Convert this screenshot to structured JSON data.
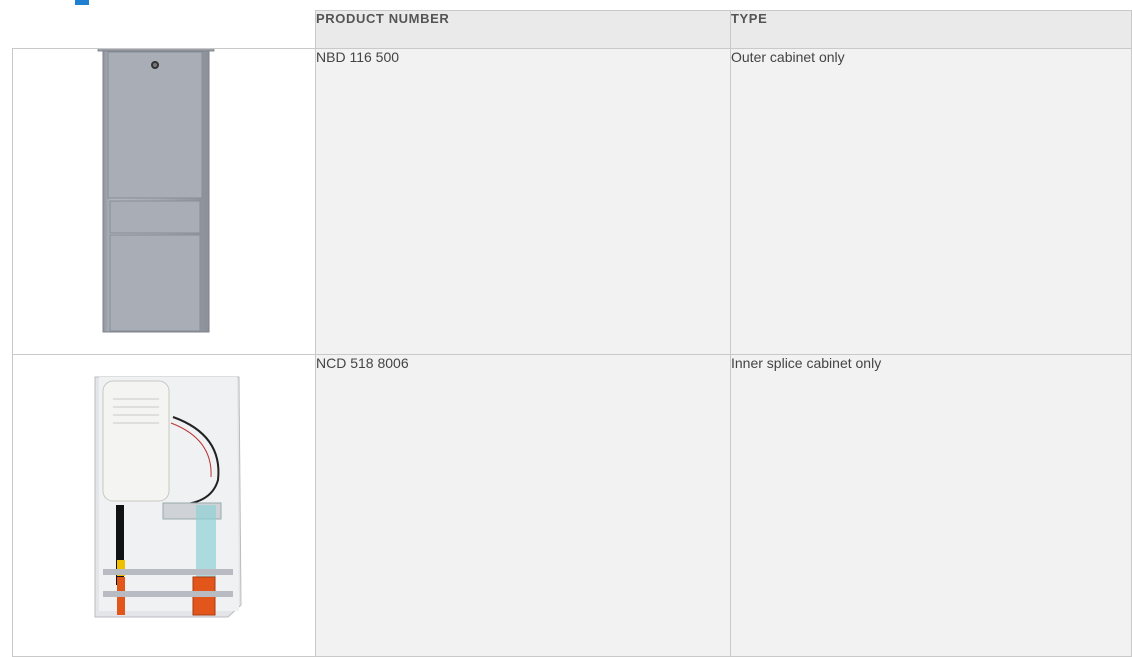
{
  "table": {
    "headers": [
      "",
      "PRODUCT NUMBER",
      "TYPE"
    ],
    "rows": [
      {
        "image": "outer-cabinet-photo",
        "product_number": "NBD 116 500",
        "type": "Outer cabinet only"
      },
      {
        "image": "inner-splice-cabinet-photo",
        "product_number": "NCD 518 8006",
        "type": "Inner splice cabinet only"
      }
    ]
  },
  "colors": {
    "header_bg": "#eaeaea",
    "cell_bg": "#f2f2f2",
    "accent": "#1f7fd0"
  }
}
